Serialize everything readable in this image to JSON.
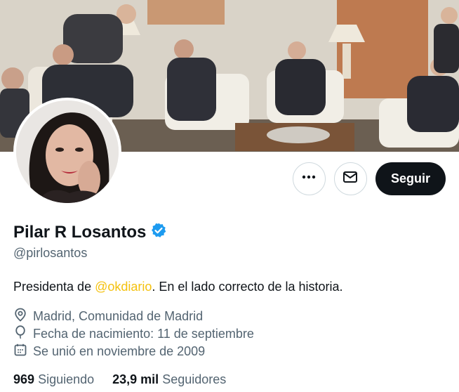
{
  "profile": {
    "name": "Pilar R Losantos",
    "handle": "@pirlosantos",
    "verified": true,
    "verified_color": "#1d9bf0",
    "bio_prefix": "Presidenta de ",
    "bio_mention": "@okdiario",
    "bio_suffix": ". En el lado correcto de la historia.",
    "mention_color": "#f4c10f",
    "location": "Madrid, Comunidad de Madrid",
    "birthday": "Fecha de nacimiento: 11 de septiembre",
    "joined": "Se unió en noviembre de 2009"
  },
  "actions": {
    "more_icon": "more-horizontal-icon",
    "message_icon": "envelope-icon",
    "follow_label": "Seguir"
  },
  "stats": {
    "following_count": "969",
    "following_label": "Siguiendo",
    "followers_count": "23,9 mil",
    "followers_label": "Seguidores"
  }
}
